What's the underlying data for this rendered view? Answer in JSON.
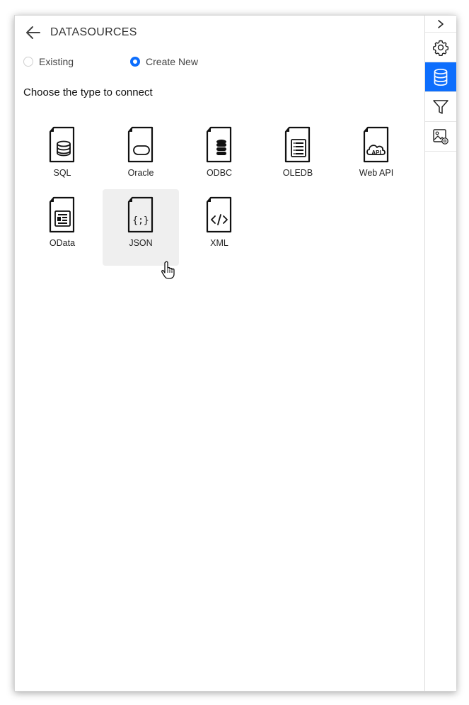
{
  "header": {
    "title": "DATASOURCES"
  },
  "mode": {
    "options": [
      {
        "label": "Existing",
        "checked": false
      },
      {
        "label": "Create New",
        "checked": true
      }
    ]
  },
  "prompt": "Choose the type to connect",
  "types": [
    {
      "label": "SQL",
      "icon": "sql-database-icon"
    },
    {
      "label": "Oracle",
      "icon": "oracle-icon"
    },
    {
      "label": "ODBC",
      "icon": "odbc-icon"
    },
    {
      "label": "OLEDB",
      "icon": "oledb-icon"
    },
    {
      "label": "Web API",
      "icon": "web-api-icon"
    },
    {
      "label": "OData",
      "icon": "odata-icon"
    },
    {
      "label": "JSON",
      "icon": "json-icon"
    },
    {
      "label": "XML",
      "icon": "xml-icon"
    }
  ],
  "hovered_type": "JSON",
  "rail": {
    "items": [
      "collapse-chevron-icon",
      "gear-icon",
      "database-icon",
      "filter-icon",
      "image-settings-icon"
    ],
    "active": "database-icon"
  },
  "colors": {
    "accent": "#0d6efd",
    "hover_bg": "#efefef"
  }
}
